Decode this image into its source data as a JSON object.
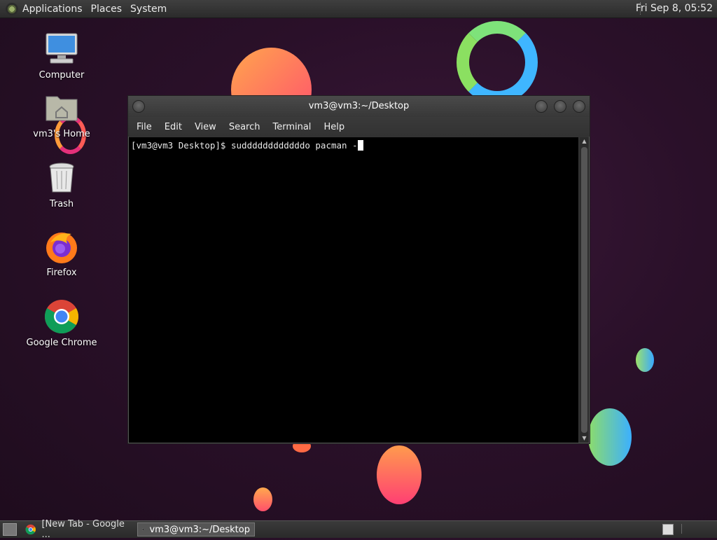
{
  "top_panel": {
    "menus": [
      "Applications",
      "Places",
      "System"
    ],
    "clock": "Fri Sep  8, 05:52"
  },
  "desktop": {
    "icons": [
      {
        "label": "Computer",
        "icon": "computer-icon"
      },
      {
        "label": "vm3's Home",
        "icon": "home-folder-icon"
      },
      {
        "label": "Trash",
        "icon": "trash-icon"
      },
      {
        "label": "Firefox",
        "icon": "firefox-icon"
      },
      {
        "label": "Google Chrome",
        "icon": "chrome-icon"
      }
    ]
  },
  "terminal": {
    "title": "vm3@vm3:~/Desktop",
    "menu": [
      "File",
      "Edit",
      "View",
      "Search",
      "Terminal",
      "Help"
    ],
    "prompt": "[vm3@vm3 Desktop]$ ",
    "command": "suddddddddddddo pacman -"
  },
  "taskbar": {
    "tasks": [
      {
        "label": "[New Tab - Google ...",
        "icon": "chrome-icon",
        "active": false
      },
      {
        "label": "vm3@vm3:~/Desktop",
        "icon": "terminal-icon",
        "active": true
      }
    ]
  }
}
